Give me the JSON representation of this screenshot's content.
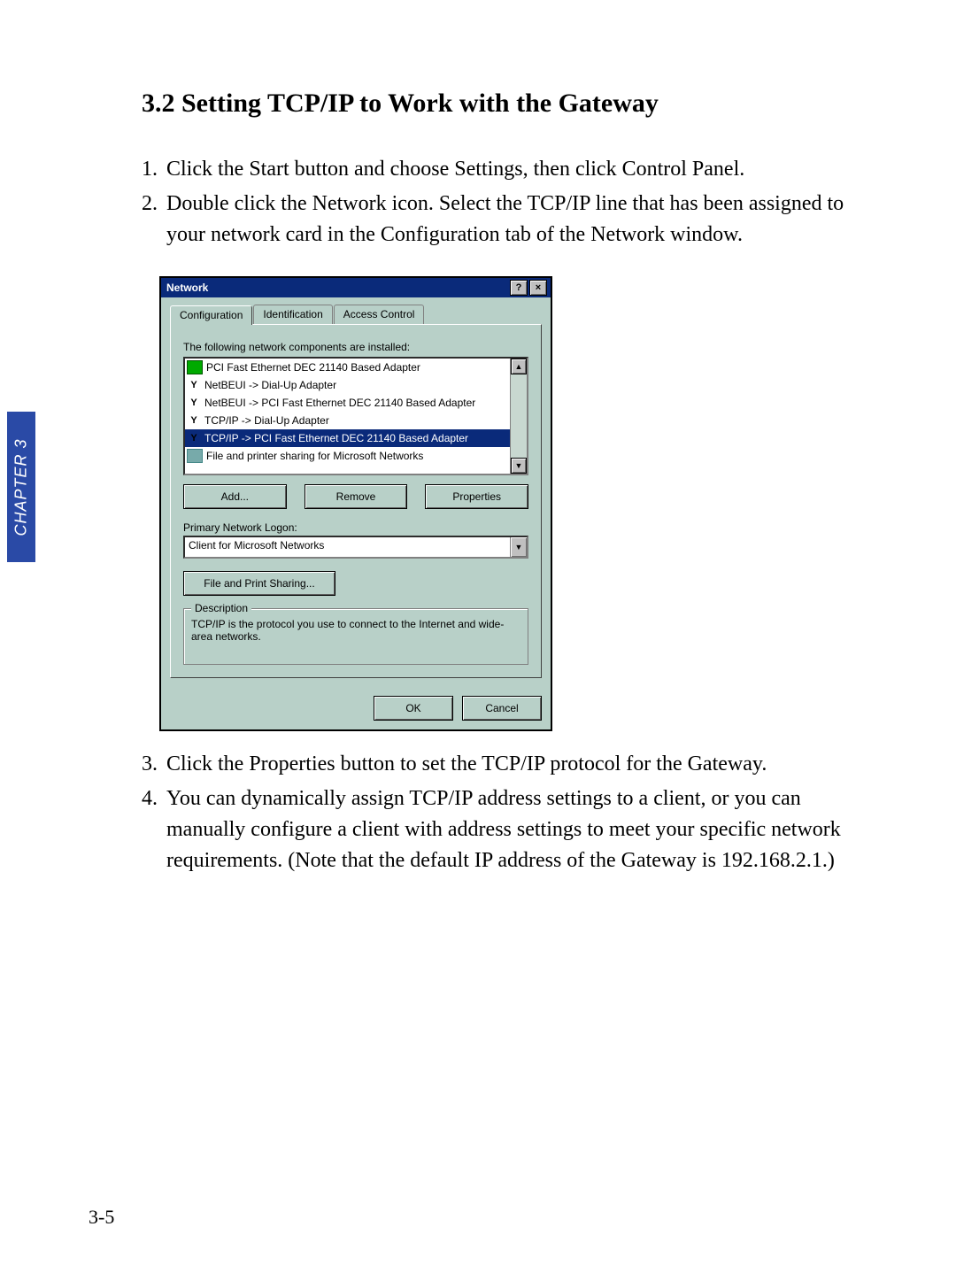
{
  "sidebar": {
    "chapter_label": "CHAPTER 3"
  },
  "section": {
    "title": "3.2 Setting TCP/IP to Work with the Gateway"
  },
  "steps_before": [
    {
      "n": "1.",
      "t": "Click the Start button and choose Settings, then click Control Panel."
    },
    {
      "n": "2.",
      "t": "Double click the Network icon. Select the TCP/IP line that has been assigned to your network card in the Configuration tab of the Network window."
    }
  ],
  "steps_after": [
    {
      "n": "3.",
      "t": "Click the Properties button to set the TCP/IP protocol for the Gateway."
    },
    {
      "n": "4.",
      "t": "You can dynamically assign TCP/IP address settings to a client, or you can manually configure a client with address settings to meet your specific network requirements. (Note that the default IP address of the Gateway is 192.168.2.1.)"
    }
  ],
  "page_number": "3-5",
  "dialog": {
    "title": "Network",
    "help_btn": "?",
    "close_btn": "×",
    "tabs": [
      "Configuration",
      "Identification",
      "Access Control"
    ],
    "active_tab": 0,
    "list_label": "The following network components are installed:",
    "items": [
      {
        "icon": "adapter",
        "text": "PCI Fast Ethernet DEC 21140 Based Adapter",
        "selected": false
      },
      {
        "icon": "proto",
        "text": "NetBEUI -> Dial-Up Adapter",
        "selected": false
      },
      {
        "icon": "proto",
        "text": "NetBEUI -> PCI Fast Ethernet DEC 21140 Based Adapter",
        "selected": false
      },
      {
        "icon": "proto",
        "text": "TCP/IP -> Dial-Up Adapter",
        "selected": false
      },
      {
        "icon": "proto",
        "text": "TCP/IP -> PCI Fast Ethernet DEC 21140 Based Adapter",
        "selected": true
      },
      {
        "icon": "share",
        "text": "File and printer sharing for Microsoft Networks",
        "selected": false
      }
    ],
    "buttons": {
      "add": "Add...",
      "remove": "Remove",
      "properties": "Properties"
    },
    "logon_label": "Primary Network Logon:",
    "logon_value": "Client for Microsoft Networks",
    "share_button": "File and Print Sharing...",
    "group_title": "Description",
    "group_text": "TCP/IP is the protocol you use to connect to the Internet and wide-area networks.",
    "ok": "OK",
    "cancel": "Cancel"
  }
}
